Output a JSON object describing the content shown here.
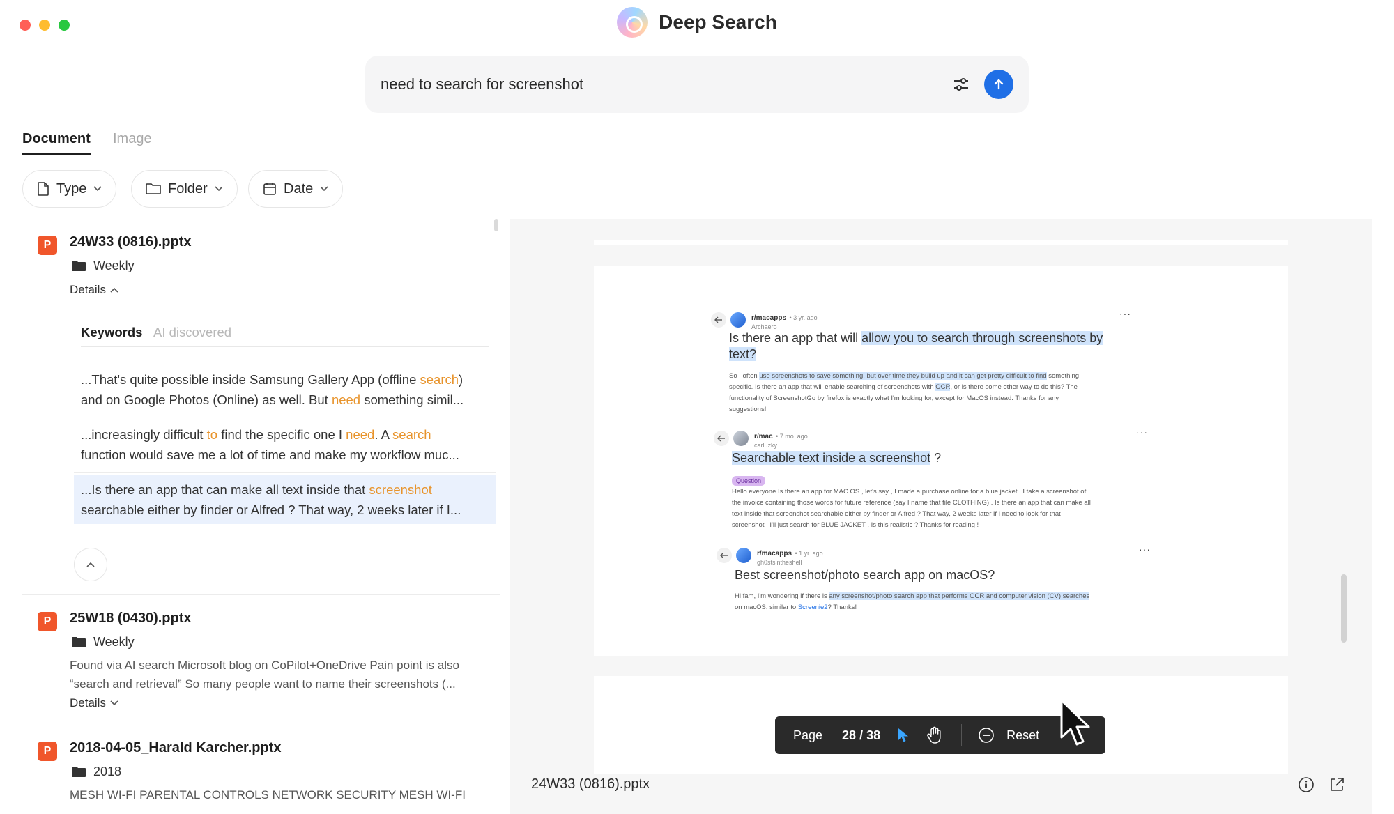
{
  "window": {
    "title": "Deep Search",
    "colors": {
      "close": "#ff5f57",
      "minimize": "#febc2e",
      "maximize": "#28c840",
      "accent": "#1f6fe6",
      "highlight": "#e8942c"
    }
  },
  "search": {
    "query": "need to search for screenshot"
  },
  "tabs": [
    {
      "label": "Document",
      "active": true
    },
    {
      "label": "Image",
      "active": false
    }
  ],
  "filters": [
    {
      "label": "Type",
      "icon": "file-icon"
    },
    {
      "label": "Folder",
      "icon": "folder-icon"
    },
    {
      "label": "Date",
      "icon": "calendar-icon"
    }
  ],
  "results": [
    {
      "type_badge": "P",
      "name": "24W33 (0816).pptx",
      "folder": "Weekly",
      "details_label": "Details",
      "subtabs": [
        "Keywords",
        "AI discovered"
      ],
      "snippets": [
        {
          "parts": [
            "...That's quite possible inside Samsung Gallery App (offline ",
            "search",
            ")"
          ],
          "line2": [
            "and on Google Photos (Online) as well. But ",
            "need",
            " something simil..."
          ]
        },
        {
          "parts": [
            "...increasingly difficult ",
            "to",
            " find the specific one I ",
            "need",
            ". A ",
            "search"
          ],
          "line2": [
            "function would save me a lot of time and make my workflow muc..."
          ]
        },
        {
          "parts": [
            "...Is there an app that can make all text inside that ",
            "screenshot"
          ],
          "line2": [
            "searchable either by finder or Alfred ? That way, 2 weeks later if I..."
          ]
        }
      ]
    },
    {
      "type_badge": "P",
      "name": "25W18 (0430).pptx",
      "folder": "Weekly",
      "desc_1": "Found via AI search Microsoft blog on CoPilot+OneDrive Pain point is also",
      "desc_2": "“search and retrieval” So many people want to name their screenshots (...",
      "details_label": "Details"
    },
    {
      "type_badge": "P",
      "name": "2018-04-05_Harald Karcher.pptx",
      "folder": "2018",
      "desc_1": "MESH WI-FI PARENTAL CONTROLS NETWORK SECURITY MESH WI-FI"
    }
  ],
  "preview": {
    "filename": "24W33 (0816).pptx",
    "posts": [
      {
        "sub": "r/macapps",
        "meta": "• 3 yr. ago",
        "user": "Archaero",
        "title_pre": "Is there an app that will ",
        "title_hl": "allow you to search through screenshots by",
        "title_hl2": "text?",
        "body_1_pre": "So I often ",
        "body_1_hl": "use screenshots to save something, but over time they build up and it can get pretty difficult to find",
        "body_1_post": " something",
        "body_2_pre": "specific. Is there an app that will enable searching of screenshots with ",
        "body_2_hl": "OCR",
        "body_2_post": ", or is there some other way to do this? The",
        "body_3": "functionality of ScreenshotGo by firefox is exactly what I'm looking for, except for MacOS instead. Thanks for any",
        "body_4": "suggestions!"
      },
      {
        "sub": "r/mac",
        "meta": "• 7 mo. ago",
        "user": "carluzky",
        "title_hl": "Searchable text inside a screenshot",
        "title_post": " ?",
        "tag": "Question",
        "body_1": "Hello everyone Is there an app for MAC OS , let's say , I made a purchase online for a blue jacket , I take a screenshot of",
        "body_2": "the invoice containing those words for future reference (say I name that file CLOTHING) . Is there an app that can make all",
        "body_3": "text inside that screenshot searchable either by finder or Alfred ? That way, 2 weeks later if I need to look for that",
        "body_4": "screenshot , I'll just search for BLUE JACKET . Is this realistic ? Thanks for reading !"
      },
      {
        "sub": "r/macapps",
        "meta": "• 1 yr. ago",
        "user": "gh0stsintheshell",
        "title": "Best screenshot/photo search app on macOS?",
        "body_1_pre": "Hi fam, I'm wondering if there is ",
        "body_1_hl": "any screenshot/photo search app that performs OCR and computer vision (CV) searches",
        "body_2_pre": "on macOS, similar to ",
        "body_2_link": "Screenie2",
        "body_2_post": "? Thanks!"
      }
    ],
    "toolbar": {
      "page_label": "Page",
      "page_value": "28 / 38",
      "reset_label": "Reset"
    }
  }
}
